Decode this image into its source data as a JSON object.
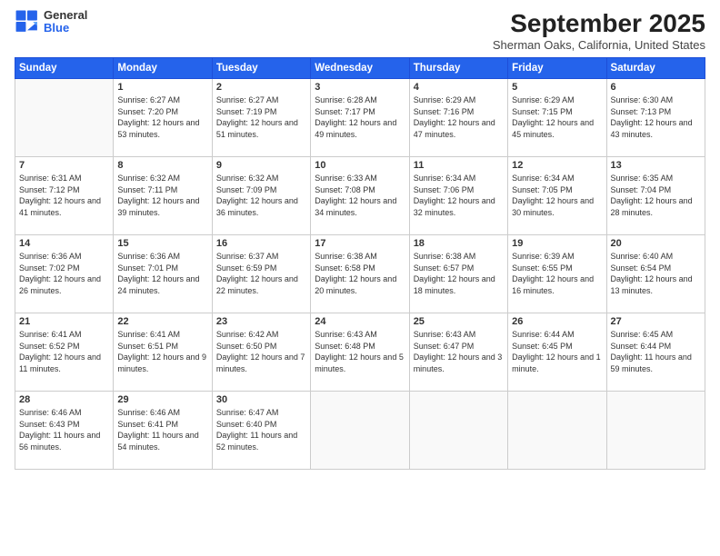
{
  "header": {
    "logo_general": "General",
    "logo_blue": "Blue",
    "month_title": "September 2025",
    "location": "Sherman Oaks, California, United States"
  },
  "weekdays": [
    "Sunday",
    "Monday",
    "Tuesday",
    "Wednesday",
    "Thursday",
    "Friday",
    "Saturday"
  ],
  "weeks": [
    [
      {
        "day": "",
        "sunrise": "",
        "sunset": "",
        "daylight": ""
      },
      {
        "day": "1",
        "sunrise": "Sunrise: 6:27 AM",
        "sunset": "Sunset: 7:20 PM",
        "daylight": "Daylight: 12 hours and 53 minutes."
      },
      {
        "day": "2",
        "sunrise": "Sunrise: 6:27 AM",
        "sunset": "Sunset: 7:19 PM",
        "daylight": "Daylight: 12 hours and 51 minutes."
      },
      {
        "day": "3",
        "sunrise": "Sunrise: 6:28 AM",
        "sunset": "Sunset: 7:17 PM",
        "daylight": "Daylight: 12 hours and 49 minutes."
      },
      {
        "day": "4",
        "sunrise": "Sunrise: 6:29 AM",
        "sunset": "Sunset: 7:16 PM",
        "daylight": "Daylight: 12 hours and 47 minutes."
      },
      {
        "day": "5",
        "sunrise": "Sunrise: 6:29 AM",
        "sunset": "Sunset: 7:15 PM",
        "daylight": "Daylight: 12 hours and 45 minutes."
      },
      {
        "day": "6",
        "sunrise": "Sunrise: 6:30 AM",
        "sunset": "Sunset: 7:13 PM",
        "daylight": "Daylight: 12 hours and 43 minutes."
      }
    ],
    [
      {
        "day": "7",
        "sunrise": "Sunrise: 6:31 AM",
        "sunset": "Sunset: 7:12 PM",
        "daylight": "Daylight: 12 hours and 41 minutes."
      },
      {
        "day": "8",
        "sunrise": "Sunrise: 6:32 AM",
        "sunset": "Sunset: 7:11 PM",
        "daylight": "Daylight: 12 hours and 39 minutes."
      },
      {
        "day": "9",
        "sunrise": "Sunrise: 6:32 AM",
        "sunset": "Sunset: 7:09 PM",
        "daylight": "Daylight: 12 hours and 36 minutes."
      },
      {
        "day": "10",
        "sunrise": "Sunrise: 6:33 AM",
        "sunset": "Sunset: 7:08 PM",
        "daylight": "Daylight: 12 hours and 34 minutes."
      },
      {
        "day": "11",
        "sunrise": "Sunrise: 6:34 AM",
        "sunset": "Sunset: 7:06 PM",
        "daylight": "Daylight: 12 hours and 32 minutes."
      },
      {
        "day": "12",
        "sunrise": "Sunrise: 6:34 AM",
        "sunset": "Sunset: 7:05 PM",
        "daylight": "Daylight: 12 hours and 30 minutes."
      },
      {
        "day": "13",
        "sunrise": "Sunrise: 6:35 AM",
        "sunset": "Sunset: 7:04 PM",
        "daylight": "Daylight: 12 hours and 28 minutes."
      }
    ],
    [
      {
        "day": "14",
        "sunrise": "Sunrise: 6:36 AM",
        "sunset": "Sunset: 7:02 PM",
        "daylight": "Daylight: 12 hours and 26 minutes."
      },
      {
        "day": "15",
        "sunrise": "Sunrise: 6:36 AM",
        "sunset": "Sunset: 7:01 PM",
        "daylight": "Daylight: 12 hours and 24 minutes."
      },
      {
        "day": "16",
        "sunrise": "Sunrise: 6:37 AM",
        "sunset": "Sunset: 6:59 PM",
        "daylight": "Daylight: 12 hours and 22 minutes."
      },
      {
        "day": "17",
        "sunrise": "Sunrise: 6:38 AM",
        "sunset": "Sunset: 6:58 PM",
        "daylight": "Daylight: 12 hours and 20 minutes."
      },
      {
        "day": "18",
        "sunrise": "Sunrise: 6:38 AM",
        "sunset": "Sunset: 6:57 PM",
        "daylight": "Daylight: 12 hours and 18 minutes."
      },
      {
        "day": "19",
        "sunrise": "Sunrise: 6:39 AM",
        "sunset": "Sunset: 6:55 PM",
        "daylight": "Daylight: 12 hours and 16 minutes."
      },
      {
        "day": "20",
        "sunrise": "Sunrise: 6:40 AM",
        "sunset": "Sunset: 6:54 PM",
        "daylight": "Daylight: 12 hours and 13 minutes."
      }
    ],
    [
      {
        "day": "21",
        "sunrise": "Sunrise: 6:41 AM",
        "sunset": "Sunset: 6:52 PM",
        "daylight": "Daylight: 12 hours and 11 minutes."
      },
      {
        "day": "22",
        "sunrise": "Sunrise: 6:41 AM",
        "sunset": "Sunset: 6:51 PM",
        "daylight": "Daylight: 12 hours and 9 minutes."
      },
      {
        "day": "23",
        "sunrise": "Sunrise: 6:42 AM",
        "sunset": "Sunset: 6:50 PM",
        "daylight": "Daylight: 12 hours and 7 minutes."
      },
      {
        "day": "24",
        "sunrise": "Sunrise: 6:43 AM",
        "sunset": "Sunset: 6:48 PM",
        "daylight": "Daylight: 12 hours and 5 minutes."
      },
      {
        "day": "25",
        "sunrise": "Sunrise: 6:43 AM",
        "sunset": "Sunset: 6:47 PM",
        "daylight": "Daylight: 12 hours and 3 minutes."
      },
      {
        "day": "26",
        "sunrise": "Sunrise: 6:44 AM",
        "sunset": "Sunset: 6:45 PM",
        "daylight": "Daylight: 12 hours and 1 minute."
      },
      {
        "day": "27",
        "sunrise": "Sunrise: 6:45 AM",
        "sunset": "Sunset: 6:44 PM",
        "daylight": "Daylight: 11 hours and 59 minutes."
      }
    ],
    [
      {
        "day": "28",
        "sunrise": "Sunrise: 6:46 AM",
        "sunset": "Sunset: 6:43 PM",
        "daylight": "Daylight: 11 hours and 56 minutes."
      },
      {
        "day": "29",
        "sunrise": "Sunrise: 6:46 AM",
        "sunset": "Sunset: 6:41 PM",
        "daylight": "Daylight: 11 hours and 54 minutes."
      },
      {
        "day": "30",
        "sunrise": "Sunrise: 6:47 AM",
        "sunset": "Sunset: 6:40 PM",
        "daylight": "Daylight: 11 hours and 52 minutes."
      },
      {
        "day": "",
        "sunrise": "",
        "sunset": "",
        "daylight": ""
      },
      {
        "day": "",
        "sunrise": "",
        "sunset": "",
        "daylight": ""
      },
      {
        "day": "",
        "sunrise": "",
        "sunset": "",
        "daylight": ""
      },
      {
        "day": "",
        "sunrise": "",
        "sunset": "",
        "daylight": ""
      }
    ]
  ]
}
